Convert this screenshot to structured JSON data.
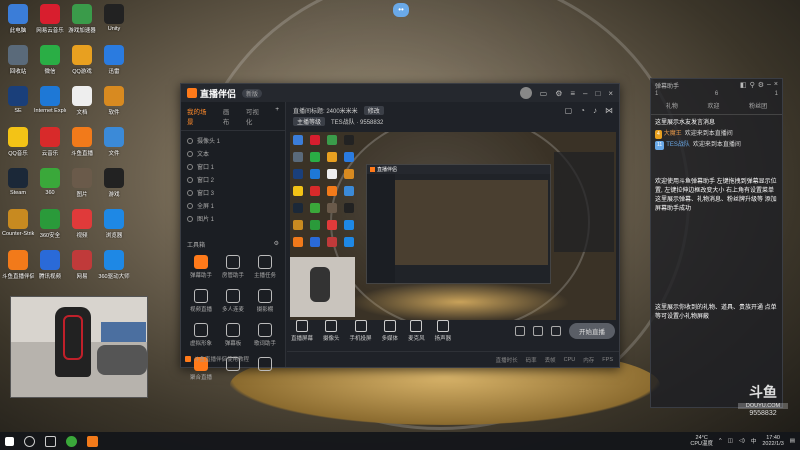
{
  "desktop": {
    "icons": [
      {
        "label": "此电脑",
        "color": "#3b7dd8"
      },
      {
        "label": "网易云音乐",
        "color": "#d81e2e"
      },
      {
        "label": "游戏加速器",
        "color": "#3a9b4a"
      },
      {
        "label": "Unity",
        "color": "#222222"
      },
      {
        "label": "回收站",
        "color": "#5a6a7a"
      },
      {
        "label": "微信",
        "color": "#2aae45"
      },
      {
        "label": "QQ游戏",
        "color": "#e8a020"
      },
      {
        "label": "迅雷",
        "color": "#2a7be0"
      },
      {
        "label": "SE",
        "color": "#1a3f7a"
      },
      {
        "label": "Internet Explorer",
        "color": "#1e78d6"
      },
      {
        "label": "文档",
        "color": "#eeeeee"
      },
      {
        "label": "软件",
        "color": "#d88a20"
      },
      {
        "label": "QQ音乐",
        "color": "#f3c316"
      },
      {
        "label": "云音乐",
        "color": "#d82a2a"
      },
      {
        "label": "斗鱼直播",
        "color": "#f27a1a"
      },
      {
        "label": "文件",
        "color": "#3b8ad8"
      },
      {
        "label": "Steam",
        "color": "#1b2838"
      },
      {
        "label": "360",
        "color": "#3aa83a"
      },
      {
        "label": "图片",
        "color": "#6a5a4a"
      },
      {
        "label": "游戏",
        "color": "#222222"
      },
      {
        "label": "Counter-Strike",
        "color": "#c88a20"
      },
      {
        "label": "360安全",
        "color": "#2a9a3a"
      },
      {
        "label": "视频",
        "color": "#e03a3a"
      },
      {
        "label": "浏览器",
        "color": "#1e88e5"
      },
      {
        "label": "斗鱼直播伴侣",
        "color": "#f27a1a"
      },
      {
        "label": "腾讯视频",
        "color": "#2a6ad8"
      },
      {
        "label": "网易",
        "color": "#c03a3a"
      },
      {
        "label": "360驱动大师",
        "color": "#1e88e5"
      }
    ],
    "top_badge": "••"
  },
  "app": {
    "title": "直播伴侣",
    "version": "新版",
    "left_tabs": [
      "我的场景",
      "画布",
      "可视化"
    ],
    "left_tabs_add": "+",
    "sources": [
      "摄像头 1",
      "文本",
      "窗口 1",
      "窗口 2",
      "窗口 3",
      "全屏 1",
      "图片 1"
    ],
    "tools_title": "工具箱",
    "tools": [
      {
        "label": "弹幕助手"
      },
      {
        "label": "房管助手"
      },
      {
        "label": "主播任务"
      },
      {
        "label": "视频直播"
      },
      {
        "label": "多人连麦"
      },
      {
        "label": "摄影棚"
      },
      {
        "label": "虚拟形象"
      },
      {
        "label": "弹幕板"
      },
      {
        "label": "歌词助手"
      },
      {
        "label": "聚合直播"
      },
      {
        "label": ""
      },
      {
        "label": ""
      }
    ],
    "ad_text": "斗鱼直播伴侣使用教程",
    "info_line1": "直播间标题: 2400米米米",
    "info_line1_btn": "修改",
    "info_line2_tag": "主播等级",
    "info_line2_text": "TES战队 · 9558832",
    "bottom_buttons": [
      {
        "label": "直播屏幕"
      },
      {
        "label": "摄像头"
      },
      {
        "label": "手机投屏"
      },
      {
        "label": "多媒体"
      },
      {
        "label": "麦克风"
      },
      {
        "label": "扬声器"
      }
    ],
    "live_button": "开始直播",
    "status_items": [
      "直播时长",
      "码率",
      "丢帧",
      "CPU",
      "内存",
      "FPS"
    ]
  },
  "chat": {
    "title": "弹幕助手",
    "stats": [
      "1",
      "6",
      "1"
    ],
    "tabs": [
      "礼物",
      "欢迎",
      "粉丝团"
    ],
    "system_msg": "这里展示水友发言消息",
    "messages": [
      {
        "badge": "4",
        "badge_color": "#e8a020",
        "nick": "大魔王",
        "text": "欢迎来到本直播间"
      },
      {
        "badge": "11",
        "badge_color": "#6aa9e8",
        "nick": "TES战队",
        "text": "欢迎来到本直播间"
      }
    ],
    "notice": "欢迎使用斗鱼弹幕助手 左键拖拽到弹幕显示位置, 左键拉伸边框改变大小 右上角有设置菜单 这里展示弹幕、礼物消息、粉丝牌升级等 添加屏幕助手成功",
    "footer": "这里展示你收到的礼物、道具、贵族开通 点单等可设置小礼物屏蔽"
  },
  "watermark": {
    "logo": "斗鱼",
    "sub": "DOUYU.COM",
    "room": "9558832"
  },
  "taskbar": {
    "temp": "24°C",
    "temp_label": "CPU温度",
    "time": "17:40",
    "date": "2022/1/3"
  }
}
